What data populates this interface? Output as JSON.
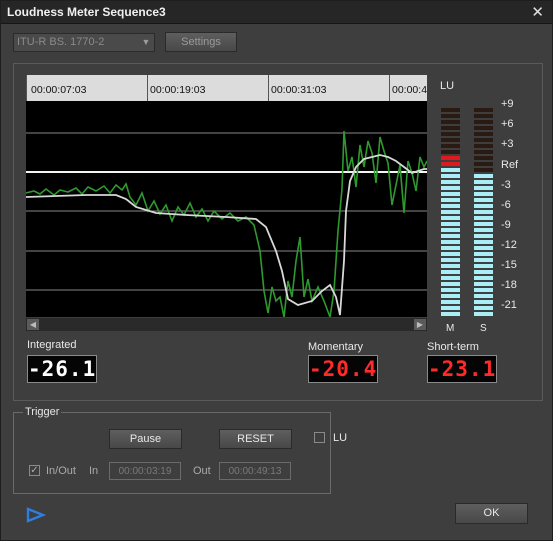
{
  "window": {
    "title": "Loudness Meter  Sequence3",
    "close_glyph": "✕"
  },
  "standard": {
    "selected": "ITU-R BS. 1770-2"
  },
  "buttons": {
    "settings": "Settings",
    "pause": "Pause",
    "reset": "RESET",
    "ok": "OK"
  },
  "timeline": {
    "ticks": [
      "00:00:07:03",
      "00:00:19:03",
      "00:00:31:03",
      "00:00:4"
    ]
  },
  "meter": {
    "unit_label": "LU",
    "scale": [
      "+9",
      "+6",
      "+3",
      "Ref",
      "-3",
      "-6",
      "-9",
      "-12",
      "-15",
      "-18",
      "-21"
    ],
    "channels": [
      "M",
      "S"
    ],
    "momentary_level_lu": 1.5,
    "short_term_level_lu": -0.5,
    "colors": {
      "lit_low": "#a9eef6",
      "lit_high": "#e0191f",
      "unlit": "#2a1a14"
    }
  },
  "readouts": {
    "integrated": {
      "label": "Integrated",
      "value": "-26.1",
      "color": "#ffffff"
    },
    "momentary": {
      "label": "Momentary",
      "value": "-20.4",
      "color": "#ff2a2a"
    },
    "short_term": {
      "label": "Short-term",
      "value": "-23.1",
      "color": "#ff2a2a"
    }
  },
  "trigger": {
    "title": "Trigger",
    "in_out_label": "In/Out",
    "in_out_checked": true,
    "in_label": "In",
    "in_value": "00:00:03:19",
    "out_label": "Out",
    "out_value": "00:00:49:13"
  },
  "lu_checkbox": {
    "label": "LU",
    "checked": false
  },
  "icons": {
    "play": "play-triangle-icon"
  }
}
